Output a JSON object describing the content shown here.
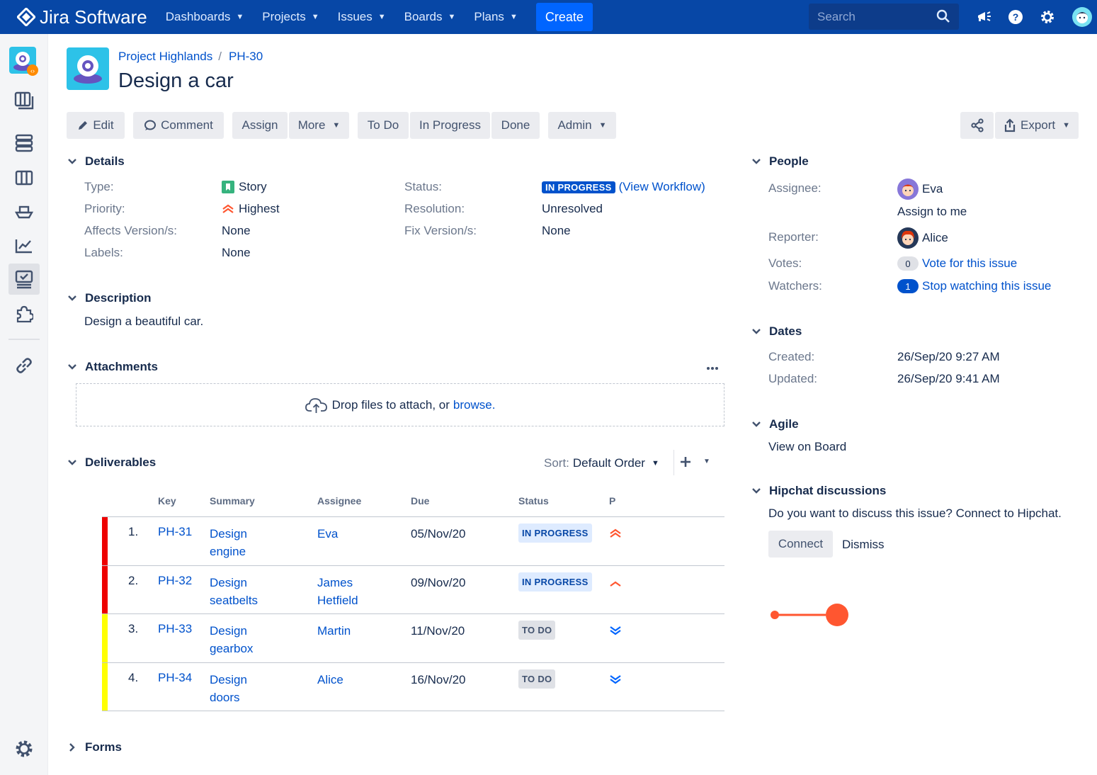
{
  "nav": {
    "logo": "Jira Software",
    "items": [
      "Dashboards",
      "Projects",
      "Issues",
      "Boards",
      "Plans"
    ],
    "create": "Create",
    "search_placeholder": "Search"
  },
  "header": {
    "project": "Project Highlands",
    "issue_key": "PH-30",
    "title": "Design a car"
  },
  "toolbar": {
    "edit": "Edit",
    "comment": "Comment",
    "assign": "Assign",
    "more": "More",
    "todo": "To Do",
    "in_progress": "In Progress",
    "done": "Done",
    "admin": "Admin",
    "export": "Export"
  },
  "details": {
    "heading": "Details",
    "type_label": "Type:",
    "type_value": "Story",
    "priority_label": "Priority:",
    "priority_value": "Highest",
    "affects_label": "Affects Version/s:",
    "affects_value": "None",
    "labels_label": "Labels:",
    "labels_value": "None",
    "status_label": "Status:",
    "status_value": "IN PROGRESS",
    "view_workflow": "(View Workflow)",
    "resolution_label": "Resolution:",
    "resolution_value": "Unresolved",
    "fix_label": "Fix Version/s:",
    "fix_value": "None"
  },
  "description": {
    "heading": "Description",
    "text": "Design a beautiful car."
  },
  "attachments": {
    "heading": "Attachments",
    "drop_text": "Drop files to attach, or",
    "browse": "browse."
  },
  "deliverables": {
    "heading": "Deliverables",
    "sort_label": "Sort:",
    "sort_value": "Default Order",
    "columns": [
      "Key",
      "Summary",
      "Assignee",
      "Due",
      "Status",
      "P"
    ],
    "rows": [
      {
        "num": "1.",
        "key": "PH-31",
        "summary1": "Design",
        "summary2": "engine",
        "assignee1": "Eva",
        "assignee2": "",
        "due": "05/Nov/20",
        "status": "IN PROGRESS",
        "color": "#ee0000",
        "priority": "highest"
      },
      {
        "num": "2.",
        "key": "PH-32",
        "summary1": "Design",
        "summary2": "seatbelts",
        "assignee1": "James",
        "assignee2": "Hetfield",
        "due": "09/Nov/20",
        "status": "IN PROGRESS",
        "color": "#ee0000",
        "priority": "high"
      },
      {
        "num": "3.",
        "key": "PH-33",
        "summary1": "Design",
        "summary2": "gearbox",
        "assignee1": "Martin",
        "assignee2": "",
        "due": "11/Nov/20",
        "status": "TO DO",
        "color": "#ffff00",
        "priority": "lowest"
      },
      {
        "num": "4.",
        "key": "PH-34",
        "summary1": "Design",
        "summary2": "doors",
        "assignee1": "Alice",
        "assignee2": "",
        "due": "16/Nov/20",
        "status": "TO DO",
        "color": "#ffff00",
        "priority": "lowest"
      }
    ]
  },
  "forms": {
    "heading": "Forms"
  },
  "people": {
    "heading": "People",
    "assignee_label": "Assignee:",
    "assignee_value": "Eva",
    "assign_to_me": "Assign to me",
    "reporter_label": "Reporter:",
    "reporter_value": "Alice",
    "votes_label": "Votes:",
    "votes_count": "0",
    "vote_link": "Vote for this issue",
    "watchers_label": "Watchers:",
    "watchers_count": "1",
    "watch_link": "Stop watching this issue"
  },
  "dates": {
    "heading": "Dates",
    "created_label": "Created:",
    "created_value": "26/Sep/20 9:27 AM",
    "updated_label": "Updated:",
    "updated_value": "26/Sep/20 9:41 AM"
  },
  "agile": {
    "heading": "Agile",
    "link": "View on Board"
  },
  "hipchat": {
    "heading": "Hipchat discussions",
    "text": "Do you want to discuss this issue? Connect to Hipchat.",
    "connect": "Connect",
    "dismiss": "Dismiss"
  },
  "colors": {
    "nav": "#0747a6",
    "accent": "#0052cc",
    "cursor": "#ff5630"
  }
}
